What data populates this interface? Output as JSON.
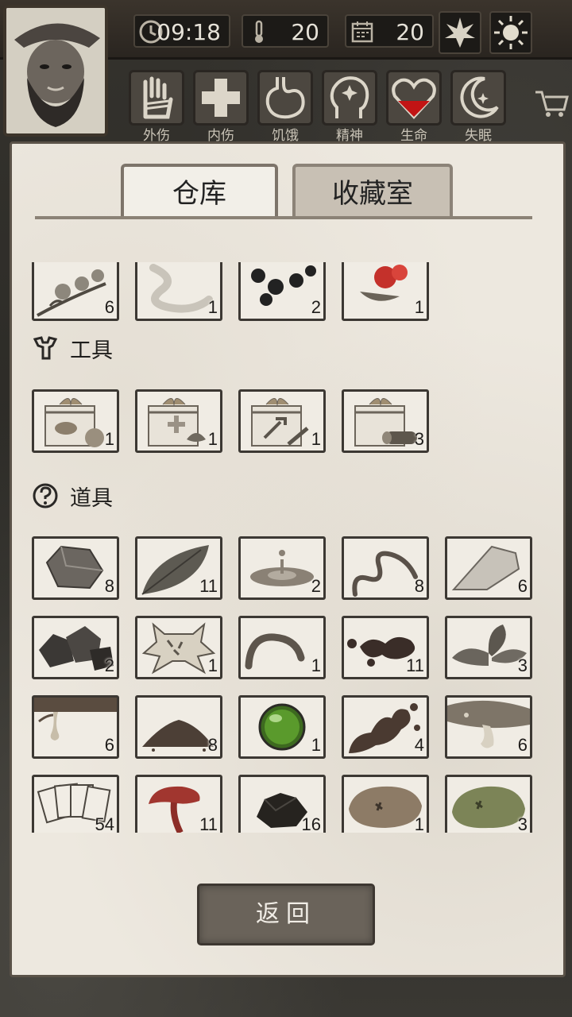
{
  "status_bar": {
    "time": "09:18",
    "temperature": "20",
    "day": "20",
    "icons": [
      "clock-icon",
      "thermometer-icon",
      "calendar-icon",
      "leaf-icon",
      "sun-icon"
    ]
  },
  "conditions": [
    {
      "id": "external-injury",
      "label": "外伤",
      "icon": "hand-bandage-icon"
    },
    {
      "id": "internal-injury",
      "label": "内伤",
      "icon": "medical-cross-icon"
    },
    {
      "id": "hunger",
      "label": "饥饿",
      "icon": "stomach-icon"
    },
    {
      "id": "spirit",
      "label": "精神",
      "icon": "head-sparkle-icon"
    },
    {
      "id": "life",
      "label": "生命",
      "icon": "heart-icon"
    },
    {
      "id": "insomnia",
      "label": "失眠",
      "icon": "moon-star-icon"
    }
  ],
  "tabs": {
    "warehouse": "仓库",
    "collection": "收藏室"
  },
  "sections": {
    "tools": "工具",
    "props": "道具"
  },
  "items_top": [
    {
      "icon": "flower-branch-icon",
      "qty": "6"
    },
    {
      "icon": "white-ribbon-icon",
      "qty": "1"
    },
    {
      "icon": "black-pellets-icon",
      "qty": "2"
    },
    {
      "icon": "red-berries-icon",
      "qty": "1"
    }
  ],
  "tools": [
    {
      "icon": "gift-box-food-icon",
      "qty": "1"
    },
    {
      "icon": "gift-box-medical-icon",
      "qty": "1"
    },
    {
      "icon": "gift-box-tools-icon",
      "qty": "1"
    },
    {
      "icon": "gift-box-wood-icon",
      "qty": "3"
    }
  ],
  "props": [
    {
      "icon": "stone-icon",
      "qty": "8"
    },
    {
      "icon": "leaf-item-icon",
      "qty": "11"
    },
    {
      "icon": "water-drop-icon",
      "qty": "2"
    },
    {
      "icon": "worm-vine-icon",
      "qty": "8"
    },
    {
      "icon": "flint-icon",
      "qty": "6"
    },
    {
      "icon": "ore-chunks-icon",
      "qty": "2"
    },
    {
      "icon": "animal-pelt-icon",
      "qty": "1"
    },
    {
      "icon": "earthworm-icon",
      "qty": "1"
    },
    {
      "icon": "dark-liquid-icon",
      "qty": "11"
    },
    {
      "icon": "herb-leaves-icon",
      "qty": "3"
    },
    {
      "icon": "tree-sap-icon",
      "qty": "6"
    },
    {
      "icon": "soil-pile-icon",
      "qty": "8"
    },
    {
      "icon": "green-orb-icon",
      "qty": "1"
    },
    {
      "icon": "mud-splash-icon",
      "qty": "4"
    },
    {
      "icon": "fish-oil-icon",
      "qty": "6"
    },
    {
      "icon": "playing-cards-icon",
      "qty": "54"
    },
    {
      "icon": "lingzhi-mushroom-icon",
      "qty": "11"
    },
    {
      "icon": "coal-icon",
      "qty": "16"
    },
    {
      "icon": "brown-moss-icon",
      "qty": "1"
    },
    {
      "icon": "green-moss-icon",
      "qty": "3"
    }
  ],
  "back_button": "返回"
}
